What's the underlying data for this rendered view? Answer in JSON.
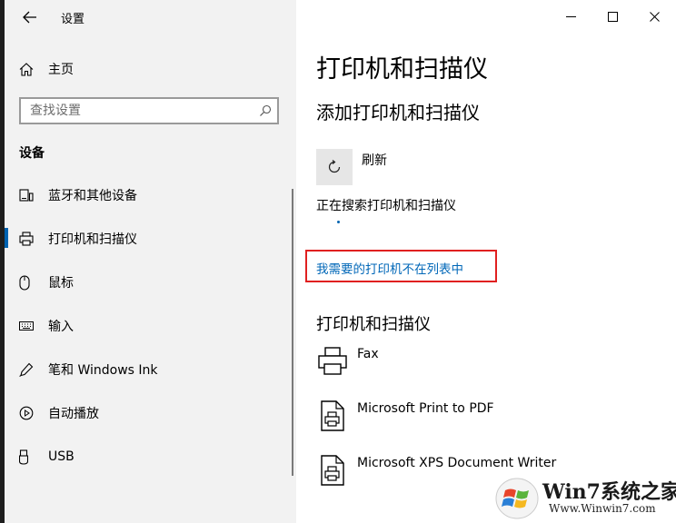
{
  "window": {
    "title": "设置",
    "controls": [
      "minimize-icon",
      "maximize-icon",
      "close-icon"
    ]
  },
  "sidebar": {
    "home_label": "主页",
    "search_placeholder": "查找设置",
    "section": "设备",
    "items": [
      {
        "label": "蓝牙和其他设备",
        "icon": "bluetooth-devices-icon",
        "selected": false
      },
      {
        "label": "打印机和扫描仪",
        "icon": "printer-icon",
        "selected": true
      },
      {
        "label": "鼠标",
        "icon": "mouse-icon",
        "selected": false
      },
      {
        "label": "输入",
        "icon": "keyboard-icon",
        "selected": false
      },
      {
        "label": "笔和 Windows Ink",
        "icon": "pen-icon",
        "selected": false
      },
      {
        "label": "自动播放",
        "icon": "autoplay-icon",
        "selected": false
      },
      {
        "label": "USB",
        "icon": "usb-icon",
        "selected": false
      }
    ]
  },
  "main": {
    "title": "打印机和扫描仪",
    "add_heading": "添加打印机和扫描仪",
    "refresh_label": "刷新",
    "searching_text": "正在搜索打印机和扫描仪",
    "missing_printer_link": "我需要的打印机不在列表中",
    "printers_heading": "打印机和扫描仪",
    "printers": [
      {
        "name": "Fax",
        "icon": "fax-icon"
      },
      {
        "name": "Microsoft Print to PDF",
        "icon": "document-printer-icon"
      },
      {
        "name": "Microsoft XPS Document Writer",
        "icon": "document-printer-icon"
      }
    ]
  },
  "watermark": {
    "brand": "Win7系统之家",
    "url": "Www.Winwin7.com"
  },
  "colors": {
    "accent": "#0063b1",
    "link": "#0067b8",
    "highlight_box": "#e02020",
    "sidebar_bg": "#f2f2f2"
  }
}
